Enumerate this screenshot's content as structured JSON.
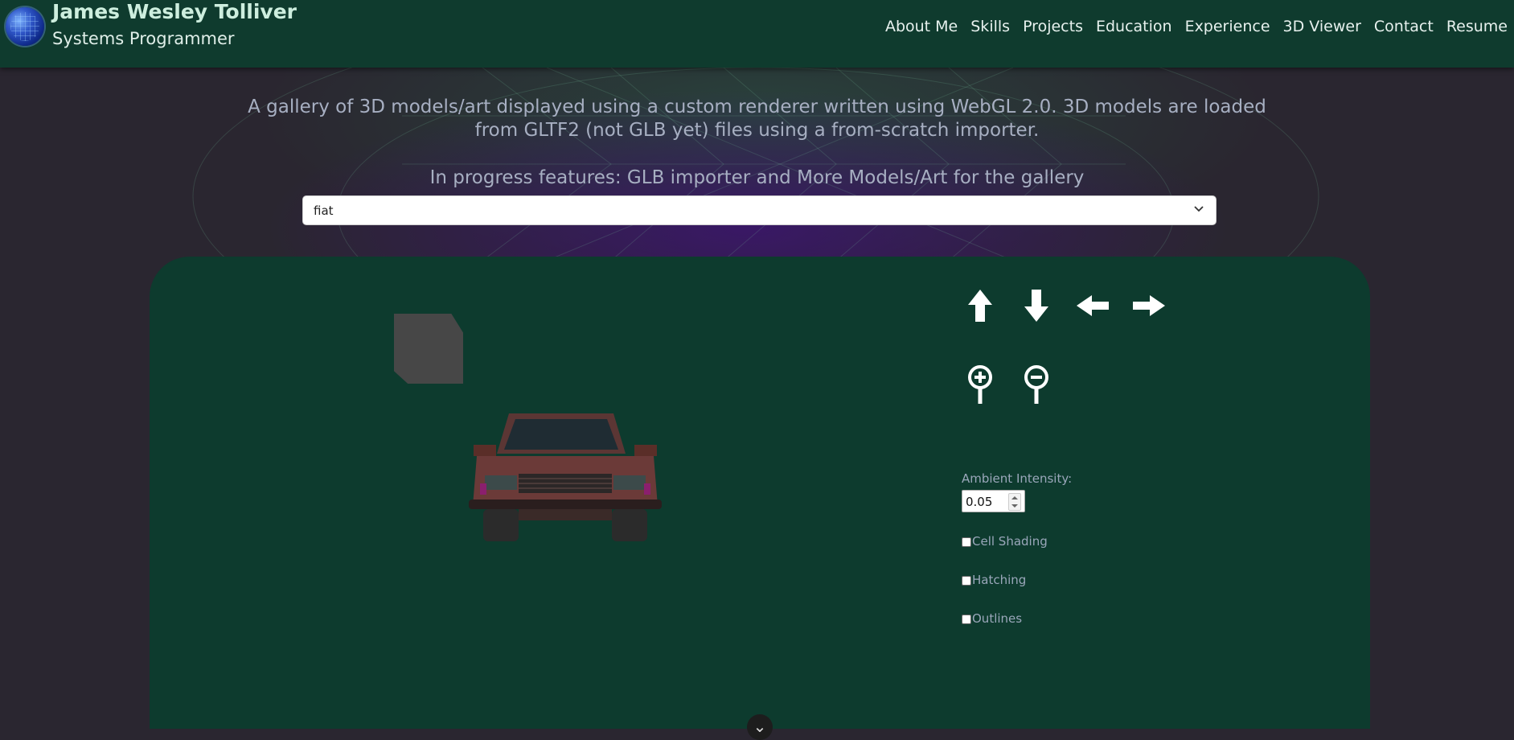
{
  "header": {
    "name": "James Wesley Tolliver",
    "role": "Systems Programmer",
    "nav": [
      "About Me",
      "Skills",
      "Projects",
      "Education",
      "Experience",
      "3D Viewer",
      "Contact",
      "Resume"
    ]
  },
  "intro": {
    "line1": "A gallery of 3D models/art displayed using a custom renderer written using WebGL 2.0. 3D models are loaded",
    "line2": "from GLTF2 (not GLB yet) files using a from-scratch importer.",
    "line3": "In progress features: GLB importer and More Models/Art for the gallery"
  },
  "model_select": {
    "selected": "fiat"
  },
  "controls": {
    "ambient_label": "Ambient Intensity:",
    "ambient_value": "0.05",
    "checkboxes": [
      {
        "label": "Cell Shading",
        "checked": false
      },
      {
        "label": "Hatching",
        "checked": false
      },
      {
        "label": "Outlines",
        "checked": false
      }
    ]
  },
  "icons": {
    "move": [
      "arrow-up-icon",
      "arrow-down-icon",
      "arrow-left-icon",
      "arrow-right-icon"
    ],
    "zoom": [
      "zoom-in-icon",
      "zoom-out-icon"
    ],
    "collapse": "chevron-down-icon"
  },
  "colors": {
    "header_bg": "#0f3b2e",
    "panel_bg": "#0d3b2e",
    "page_bg": "#2a2630",
    "car_body": "#6b3a38"
  }
}
